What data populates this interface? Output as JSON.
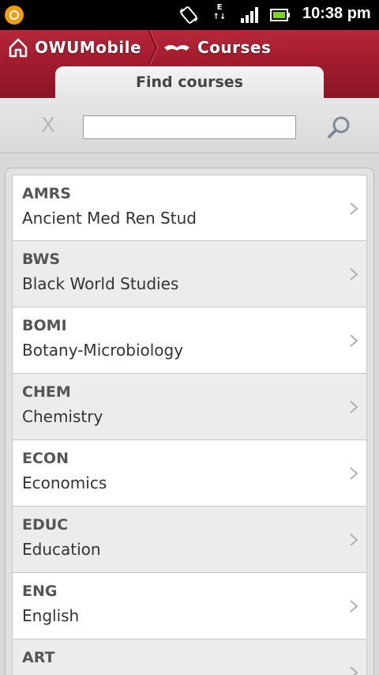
{
  "status_bar": {
    "data_indicator": "E",
    "time": "10:38 pm"
  },
  "header": {
    "home_label": "OWUMobile",
    "section_label": "Courses",
    "tab_label": "Find courses"
  },
  "search": {
    "clear_label": "X",
    "value": "",
    "placeholder": ""
  },
  "departments": [
    {
      "code": "AMRS",
      "name": "Ancient Med Ren Stud"
    },
    {
      "code": "BWS",
      "name": "Black World Studies"
    },
    {
      "code": "BOMI",
      "name": "Botany-Microbiology"
    },
    {
      "code": "CHEM",
      "name": "Chemistry"
    },
    {
      "code": "ECON",
      "name": "Economics"
    },
    {
      "code": "EDUC",
      "name": "Education"
    },
    {
      "code": "ENG",
      "name": "English"
    },
    {
      "code": "ART",
      "name": ""
    }
  ],
  "colors": {
    "brand_red": "#a41d2f",
    "status_bar": "#000000"
  }
}
